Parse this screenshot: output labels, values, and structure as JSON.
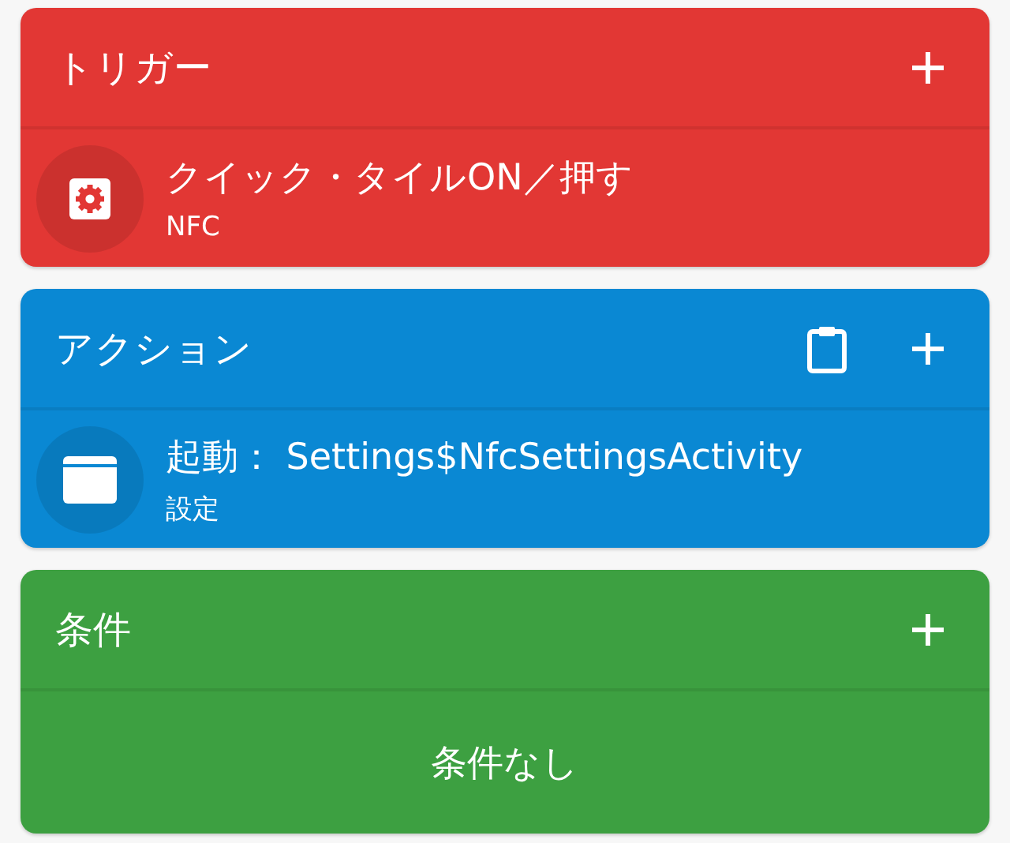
{
  "sections": [
    {
      "title": "トリガー",
      "color": "#e23734",
      "header_buttons": [
        {
          "kind": "add"
        }
      ],
      "items": [
        {
          "kind": "setting",
          "title": "クイック・タイルON／押す",
          "subtitle": "NFC"
        }
      ]
    },
    {
      "title": "アクション",
      "color": "#0a88d3",
      "header_buttons": [
        {
          "kind": "clipboard"
        },
        {
          "kind": "add"
        }
      ],
      "items": [
        {
          "kind": "activity",
          "title": "起動： Settings$NfcSettingsActivity",
          "subtitle": "設定"
        }
      ]
    },
    {
      "title": "条件",
      "color": "#3da041",
      "header_buttons": [
        {
          "kind": "add"
        }
      ],
      "empty_text": "条件なし"
    }
  ]
}
